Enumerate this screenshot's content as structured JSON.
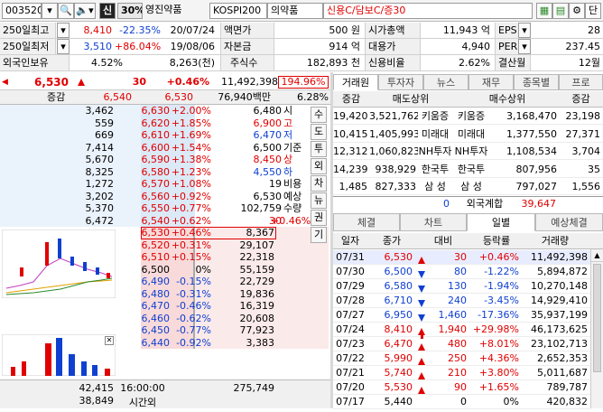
{
  "toolbar": {
    "code": "003520",
    "lock_char": "신",
    "ratio": "30%",
    "stock_name": "영진약품",
    "market": "KOSPI200",
    "sector": "의약품",
    "credit": "신용C/담보C/증30",
    "last_btn": "단"
  },
  "info": {
    "row1": {
      "l1": "250일최고",
      "v1": "8,410",
      "p1": "-22.35%",
      "d1": "20/07/24",
      "l2": "액면가",
      "v2": "500 원",
      "l3": "시가총액",
      "v3": "11,943 억",
      "l4": "EPS",
      "v4": "28"
    },
    "row2": {
      "l1": "250일최저",
      "v1": "3,510",
      "p1": "+86.04%",
      "d1": "19/08/06",
      "l2": "자본금",
      "v2": "914 억",
      "l3": "대용가",
      "v3": "4,940",
      "l4": "PER",
      "v4": "237.45"
    },
    "row3": {
      "l1": "외국인보유",
      "v1": "4.52%",
      "d1": "8,263(천)",
      "l2": "주식수",
      "v2": "182,893 천",
      "l3": "신용비율",
      "v3": "2.62%",
      "l4": "결산월",
      "v4": "12월"
    }
  },
  "quote": {
    "price": "6,530",
    "change": "30",
    "rate": "+0.46%",
    "volume": "11,492,398",
    "vol_ratio": "194.96%",
    "h_label": "증감",
    "h_a": "6,540",
    "h_b": "6,530",
    "h_amt": "76,940백만",
    "h_rate": "6.28%"
  },
  "asks": [
    {
      "qty": "3,462",
      "price": "6,630",
      "rate": "+2.00%"
    },
    {
      "qty": "559",
      "price": "6,620",
      "rate": "+1.85%"
    },
    {
      "qty": "669",
      "price": "6,610",
      "rate": "+1.69%"
    },
    {
      "qty": "7,414",
      "price": "6,600",
      "rate": "+1.54%"
    },
    {
      "qty": "5,670",
      "price": "6,590",
      "rate": "+1.38%"
    },
    {
      "qty": "8,325",
      "price": "6,580",
      "rate": "+1.23%"
    },
    {
      "qty": "1,272",
      "price": "6,570",
      "rate": "+1.08%"
    },
    {
      "qty": "3,202",
      "price": "6,560",
      "rate": "+0.92%"
    },
    {
      "qty": "5,370",
      "price": "6,550",
      "rate": "+0.77%"
    },
    {
      "qty": "6,472",
      "price": "6,540",
      "rate": "+0.62%"
    }
  ],
  "ask_info": [
    {
      "v": "6,480",
      "k": "시"
    },
    {
      "v": "6,900",
      "k": "고"
    },
    {
      "v": "6,470",
      "k": "저"
    },
    {
      "v": "6,500",
      "k": "기준"
    },
    {
      "v": "8,450",
      "k": "상"
    },
    {
      "v": "4,550",
      "k": "하"
    },
    {
      "v": "19",
      "k": "비용"
    },
    {
      "v": "6,530",
      "k": "예상"
    },
    {
      "v": "102,759",
      "k": "수량"
    },
    {
      "v": "30",
      "k": "+0.46%"
    }
  ],
  "side_tabs": [
    "수",
    "도",
    "투",
    "외",
    "차",
    "뉴",
    "권",
    "기"
  ],
  "bids": [
    {
      "price": "6,530",
      "rate": "+0.46%",
      "qty": "8,367"
    },
    {
      "price": "6,520",
      "rate": "+0.31%",
      "qty": "29,107"
    },
    {
      "price": "6,510",
      "rate": "+0.15%",
      "qty": "22,318"
    },
    {
      "price": "6,500",
      "rate": "0%",
      "qty": "55,159"
    },
    {
      "price": "6,490",
      "rate": "-0.15%",
      "qty": "22,729"
    },
    {
      "price": "6,480",
      "rate": "-0.31%",
      "qty": "19,836"
    },
    {
      "price": "6,470",
      "rate": "-0.46%",
      "qty": "16,319"
    },
    {
      "price": "6,460",
      "rate": "-0.62%",
      "qty": "20,608"
    },
    {
      "price": "6,450",
      "rate": "-0.77%",
      "qty": "77,923"
    },
    {
      "price": "6,440",
      "rate": "-0.92%",
      "qty": "3,383"
    }
  ],
  "totals": {
    "ask_total": "42,415",
    "bid_total": "38,849",
    "time": "16:00:00",
    "time_label": "시간외",
    "bid_sum": "275,749"
  },
  "broker": {
    "tabs": [
      "거래원",
      "투자자",
      "뉴스",
      "재무",
      "종목별",
      "프로"
    ],
    "head": [
      "증감",
      "매도상위",
      "매수상위",
      "증감"
    ],
    "rows": [
      {
        "d1": "19,420",
        "q1": "3,521,762",
        "n1": "키움증",
        "n2": "키움증",
        "q2": "3,168,470",
        "d2": "23,198"
      },
      {
        "d1": "10,415",
        "q1": "1,405,993",
        "n1": "미래대",
        "n2": "미래대",
        "q2": "1,377,550",
        "d2": "27,371"
      },
      {
        "d1": "12,312",
        "q1": "1,060,823",
        "n1": "NH투자",
        "n2": "NH투자",
        "q2": "1,108,534",
        "d2": "3,704"
      },
      {
        "d1": "14,239",
        "q1": "938,929",
        "n1": "한국투",
        "n2": "한국투",
        "q2": "807,956",
        "d2": "35"
      },
      {
        "d1": "1,485",
        "q1": "827,333",
        "n1": "삼 성",
        "n2": "삼 성",
        "q2": "797,027",
        "d2": "1,556"
      }
    ],
    "foreign": {
      "d1": "0",
      "label": "외국계합",
      "q2": "39,647"
    }
  },
  "daily": {
    "tabs": [
      "체결",
      "차트",
      "일별",
      "예상체결"
    ],
    "head": [
      "일자",
      "종가",
      "대비",
      "등락률",
      "거래량"
    ],
    "rows": [
      {
        "date": "07/31",
        "close": "6,530",
        "dir": "up",
        "chg": "30",
        "rate": "+0.46%",
        "vol": "11,492,398",
        "color": "red"
      },
      {
        "date": "07/30",
        "close": "6,500",
        "dir": "dn",
        "chg": "80",
        "rate": "-1.22%",
        "vol": "5,894,872",
        "color": "blue"
      },
      {
        "date": "07/29",
        "close": "6,580",
        "dir": "dn",
        "chg": "130",
        "rate": "-1.94%",
        "vol": "10,270,148",
        "color": "blue"
      },
      {
        "date": "07/28",
        "close": "6,710",
        "dir": "dn",
        "chg": "240",
        "rate": "-3.45%",
        "vol": "14,929,410",
        "color": "blue"
      },
      {
        "date": "07/27",
        "close": "6,950",
        "dir": "dn",
        "chg": "1,460",
        "rate": "-17.36%",
        "vol": "35,937,199",
        "color": "blue"
      },
      {
        "date": "07/24",
        "close": "8,410",
        "dir": "upfill",
        "chg": "1,940",
        "rate": "+29.98%",
        "vol": "46,173,625",
        "color": "red"
      },
      {
        "date": "07/23",
        "close": "6,470",
        "dir": "up",
        "chg": "480",
        "rate": "+8.01%",
        "vol": "23,102,713",
        "color": "red"
      },
      {
        "date": "07/22",
        "close": "5,990",
        "dir": "up",
        "chg": "250",
        "rate": "+4.36%",
        "vol": "2,652,353",
        "color": "red"
      },
      {
        "date": "07/21",
        "close": "5,740",
        "dir": "up",
        "chg": "210",
        "rate": "+3.80%",
        "vol": "5,011,687",
        "color": "red"
      },
      {
        "date": "07/20",
        "close": "5,530",
        "dir": "up",
        "chg": "90",
        "rate": "+1.65%",
        "vol": "789,787",
        "color": "red"
      },
      {
        "date": "07/17",
        "close": "5,440",
        "dir": "none",
        "chg": "0",
        "rate": "0%",
        "vol": "420,832",
        "color": "blk"
      }
    ]
  }
}
